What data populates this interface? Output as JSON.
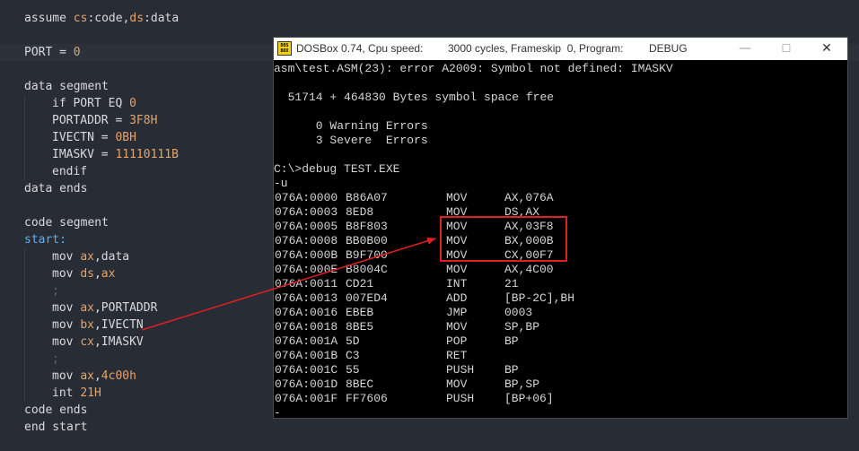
{
  "editor": {
    "lines": [
      {
        "parts": [
          {
            "t": "assume ",
            "c": "kw"
          },
          {
            "t": "cs",
            "c": "reg"
          },
          {
            "t": ":code,",
            "c": "kw"
          },
          {
            "t": "ds",
            "c": "reg"
          },
          {
            "t": ":data",
            "c": "kw"
          }
        ]
      },
      {
        "parts": []
      },
      {
        "hl": true,
        "parts": [
          {
            "t": "PORT = ",
            "c": "kw"
          },
          {
            "t": "0",
            "c": "num"
          }
        ]
      },
      {
        "parts": []
      },
      {
        "parts": [
          {
            "t": "data segment",
            "c": "kw"
          }
        ]
      },
      {
        "indent": 1,
        "parts": [
          {
            "t": "if PORT EQ ",
            "c": "kw"
          },
          {
            "t": "0",
            "c": "num"
          }
        ]
      },
      {
        "indent": 1,
        "parts": [
          {
            "t": "PORTADDR = ",
            "c": "kw"
          },
          {
            "t": "3F8H",
            "c": "num"
          }
        ]
      },
      {
        "indent": 1,
        "parts": [
          {
            "t": "IVECTN = ",
            "c": "kw"
          },
          {
            "t": "0BH",
            "c": "num"
          }
        ]
      },
      {
        "indent": 1,
        "parts": [
          {
            "t": "IMASKV = ",
            "c": "kw"
          },
          {
            "t": "11110111B",
            "c": "num"
          }
        ]
      },
      {
        "indent": 1,
        "parts": [
          {
            "t": "endif",
            "c": "kw"
          }
        ]
      },
      {
        "parts": [
          {
            "t": "data ends",
            "c": "kw"
          }
        ]
      },
      {
        "parts": []
      },
      {
        "parts": [
          {
            "t": "code segment",
            "c": "kw"
          }
        ]
      },
      {
        "parts": [
          {
            "t": "start:",
            "c": "lbl"
          }
        ]
      },
      {
        "indent": 1,
        "parts": [
          {
            "t": "mov ",
            "c": "kw"
          },
          {
            "t": "ax",
            "c": "reg"
          },
          {
            "t": ",data",
            "c": "kw"
          }
        ]
      },
      {
        "indent": 1,
        "parts": [
          {
            "t": "mov ",
            "c": "kw"
          },
          {
            "t": "ds",
            "c": "reg"
          },
          {
            "t": ",",
            "c": "kw"
          },
          {
            "t": "ax",
            "c": "reg"
          }
        ]
      },
      {
        "indent": 1,
        "parts": [
          {
            "t": ";",
            "c": "dim"
          }
        ]
      },
      {
        "indent": 1,
        "parts": [
          {
            "t": "mov ",
            "c": "kw"
          },
          {
            "t": "ax",
            "c": "reg"
          },
          {
            "t": ",PORTADDR",
            "c": "kw"
          }
        ]
      },
      {
        "indent": 1,
        "parts": [
          {
            "t": "mov ",
            "c": "kw"
          },
          {
            "t": "bx",
            "c": "reg"
          },
          {
            "t": ",IVECTN",
            "c": "kw"
          }
        ]
      },
      {
        "indent": 1,
        "parts": [
          {
            "t": "mov ",
            "c": "kw"
          },
          {
            "t": "cx",
            "c": "reg"
          },
          {
            "t": ",IMASKV",
            "c": "kw"
          }
        ]
      },
      {
        "indent": 1,
        "parts": [
          {
            "t": ";",
            "c": "dim"
          }
        ]
      },
      {
        "indent": 1,
        "parts": [
          {
            "t": "mov ",
            "c": "kw"
          },
          {
            "t": "ax",
            "c": "reg"
          },
          {
            "t": ",",
            "c": "kw"
          },
          {
            "t": "4c00h",
            "c": "num"
          }
        ]
      },
      {
        "indent": 1,
        "parts": [
          {
            "t": "int ",
            "c": "kw"
          },
          {
            "t": "21H",
            "c": "num"
          }
        ]
      },
      {
        "parts": [
          {
            "t": "code ends",
            "c": "kw"
          }
        ]
      },
      {
        "parts": [
          {
            "t": "end start",
            "c": "kw"
          }
        ]
      }
    ]
  },
  "dosbox": {
    "icon_text": "DOS BOX",
    "title": "DOSBox 0.74, Cpu speed:",
    "cycles": "3000 cycles, Frameskip  0, Program:",
    "program": "DEBUG",
    "controls": {
      "minimize": "—",
      "maximize": "☐",
      "close": "✕"
    },
    "header_lines": [
      "asm\\test.ASM(23): error A2009: Symbol not defined: IMASKV",
      "",
      "  51714 + 464830 Bytes symbol space free",
      "",
      "      0 Warning Errors",
      "      3 Severe  Errors",
      "",
      "C:\\>debug TEST.EXE",
      "-u"
    ],
    "disasm": [
      {
        "addr": "076A:0000",
        "bytes": "B86A07",
        "op": "MOV",
        "arg": "AX,076A"
      },
      {
        "addr": "076A:0003",
        "bytes": "8ED8",
        "op": "MOV",
        "arg": "DS,AX"
      },
      {
        "addr": "076A:0005",
        "bytes": "B8F803",
        "op": "MOV",
        "arg": "AX,03F8"
      },
      {
        "addr": "076A:0008",
        "bytes": "BB0B00",
        "op": "MOV",
        "arg": "BX,000B"
      },
      {
        "addr": "076A:000B",
        "bytes": "B9F700",
        "op": "MOV",
        "arg": "CX,00F7"
      },
      {
        "addr": "076A:000E",
        "bytes": "B8004C",
        "op": "MOV",
        "arg": "AX,4C00"
      },
      {
        "addr": "076A:0011",
        "bytes": "CD21",
        "op": "INT",
        "arg": "21"
      },
      {
        "addr": "076A:0013",
        "bytes": "007ED4",
        "op": "ADD",
        "arg": "[BP-2C],BH"
      },
      {
        "addr": "076A:0016",
        "bytes": "EBEB",
        "op": "JMP",
        "arg": "0003"
      },
      {
        "addr": "076A:0018",
        "bytes": "8BE5",
        "op": "MOV",
        "arg": "SP,BP"
      },
      {
        "addr": "076A:001A",
        "bytes": "5D",
        "op": "POP",
        "arg": "BP"
      },
      {
        "addr": "076A:001B",
        "bytes": "C3",
        "op": "RET",
        "arg": ""
      },
      {
        "addr": "076A:001C",
        "bytes": "55",
        "op": "PUSH",
        "arg": "BP"
      },
      {
        "addr": "076A:001D",
        "bytes": "8BEC",
        "op": "MOV",
        "arg": "BP,SP"
      },
      {
        "addr": "076A:001F",
        "bytes": "FF7606",
        "op": "PUSH",
        "arg": "[BP+06]"
      }
    ],
    "prompt": "-"
  },
  "colors": {
    "editor_bg": "#282c34",
    "editor_text": "#d7dae0",
    "register": "#e5a46b",
    "label": "#61afef",
    "annotation": "#e02020",
    "dos_bg": "#000000",
    "dos_text": "#d4d4d4"
  }
}
